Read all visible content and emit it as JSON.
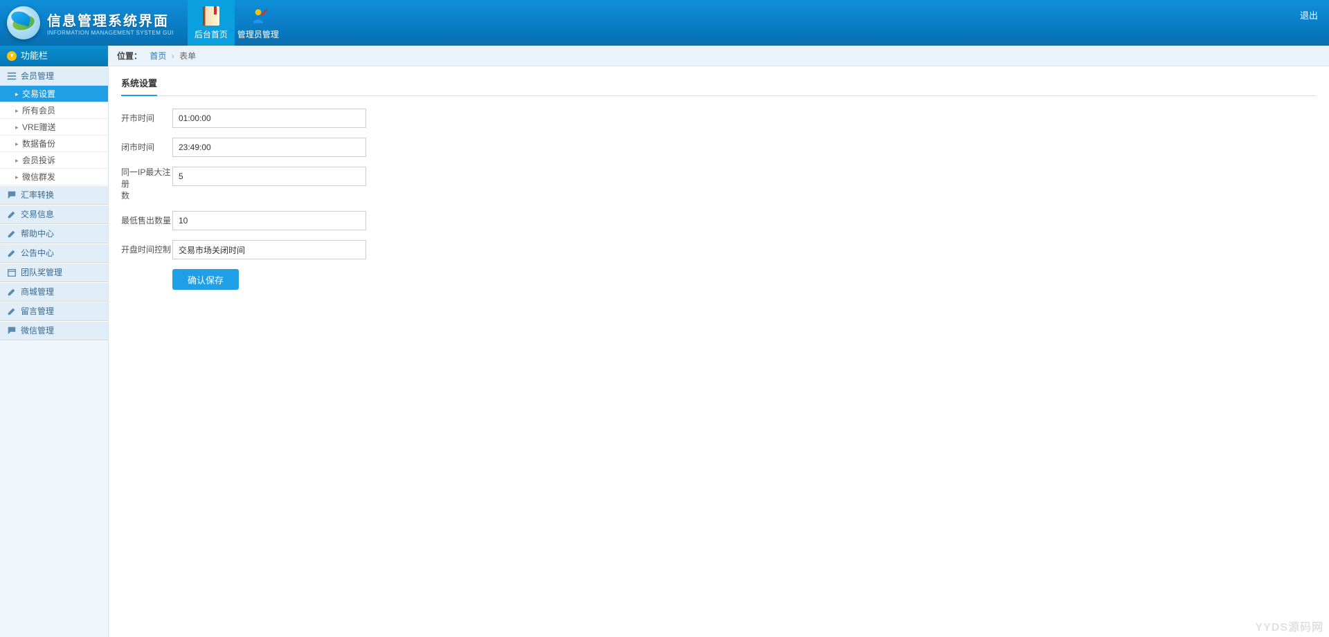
{
  "header": {
    "title": "信息管理系统界面",
    "subtitle": "INFORMATION MANAGEMENT SYSTEM GUI",
    "logout": "退出",
    "nav": [
      {
        "label": "后台首页",
        "active": true
      },
      {
        "label": "管理员管理",
        "active": false
      }
    ]
  },
  "sidebar": {
    "header": "功能栏",
    "sections": [
      {
        "label": "会员管理",
        "expanded": true,
        "items": [
          {
            "label": "交易设置",
            "active": true
          },
          {
            "label": "所有会员"
          },
          {
            "label": "VRE赠送"
          },
          {
            "label": "数据备份"
          },
          {
            "label": "会员投诉"
          },
          {
            "label": "微信群发"
          }
        ]
      },
      {
        "label": "汇率转换"
      },
      {
        "label": "交易信息"
      },
      {
        "label": "帮助中心"
      },
      {
        "label": "公告中心"
      },
      {
        "label": "团队奖管理"
      },
      {
        "label": "商城管理"
      },
      {
        "label": "留言管理"
      },
      {
        "label": "微信管理"
      }
    ]
  },
  "breadcrumb": {
    "label": "位置：",
    "home": "首页",
    "sep": "›",
    "current": "表单"
  },
  "panel": {
    "title": "系统设置",
    "fields": {
      "open_time": {
        "label": "开市时间",
        "value": "01:00:00"
      },
      "close_time": {
        "label": "闭市时间",
        "value": "23:49:00"
      },
      "max_ip": {
        "label_l1": "同一IP最大注册",
        "label_l2": "数",
        "value": "5"
      },
      "min_sell": {
        "label": "最低售出数量",
        "value": "10"
      },
      "open_ctrl": {
        "label": "开盘时间控制",
        "value": "交易市场关闭时间"
      }
    },
    "submit": "确认保存"
  },
  "watermark": "YYDS源码网"
}
